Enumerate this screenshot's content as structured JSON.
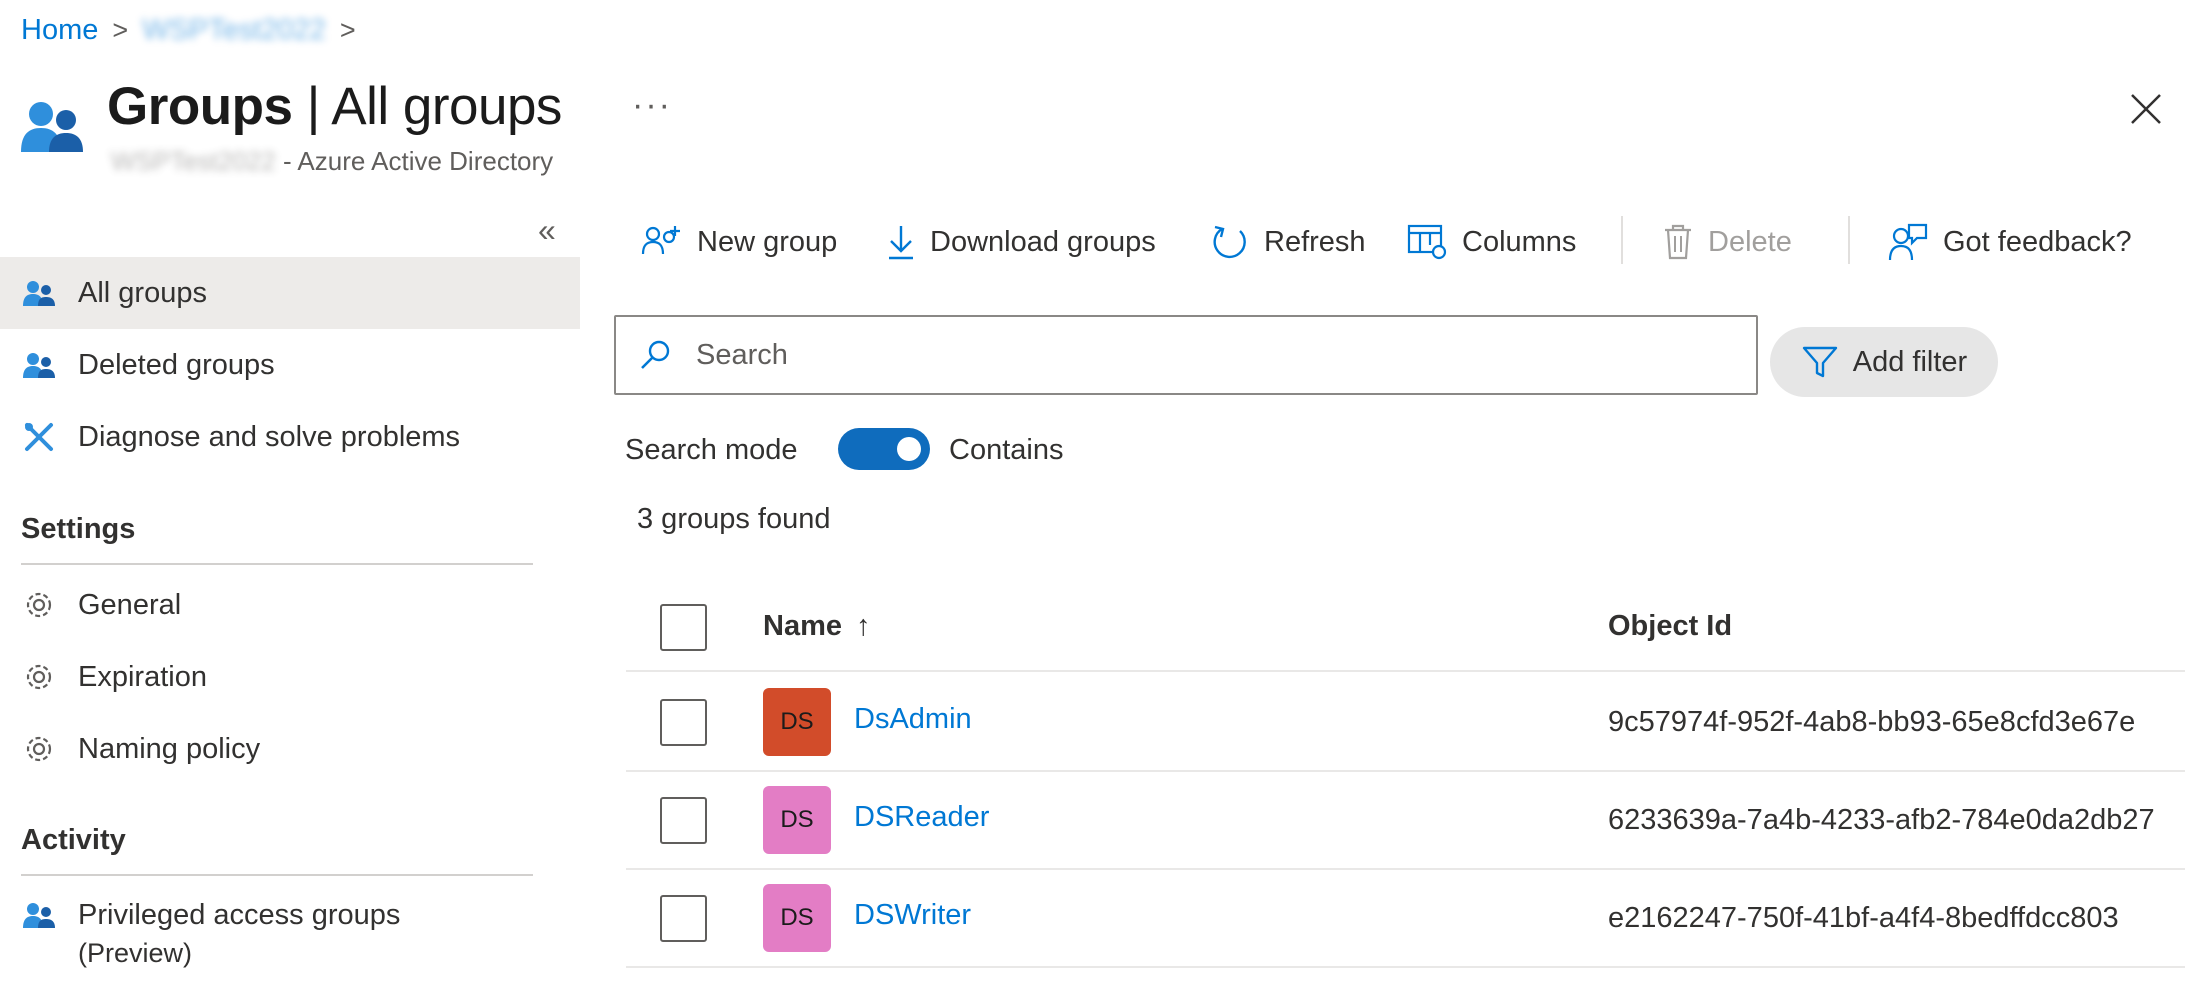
{
  "breadcrumb": {
    "home": "Home",
    "sep": ">",
    "tenant": "WSPTest2022"
  },
  "header": {
    "title": "Groups",
    "title_sep": " | ",
    "title_rest": "All groups",
    "subtitle_blurred": "WSPTest2022",
    "subtitle": " - Azure Active Directory",
    "more": "···"
  },
  "sidebar": {
    "collapse_glyph": "«",
    "items": [
      {
        "label": "All groups",
        "icon": "groups-icon",
        "active": true
      },
      {
        "label": "Deleted groups",
        "icon": "groups-icon"
      },
      {
        "label": "Diagnose and solve problems",
        "icon": "wrench-icon"
      }
    ],
    "settings": {
      "heading": "Settings",
      "items": [
        {
          "label": "General",
          "icon": "gear-icon"
        },
        {
          "label": "Expiration",
          "icon": "gear-icon"
        },
        {
          "label": "Naming policy",
          "icon": "gear-icon"
        }
      ]
    },
    "activity": {
      "heading": "Activity",
      "items": [
        {
          "label_line1": "Privileged access groups",
          "label_line2": "(Preview)",
          "icon": "groups-icon"
        }
      ]
    }
  },
  "toolbar": {
    "new_group": "New group",
    "download_groups": "Download groups",
    "refresh": "Refresh",
    "columns": "Columns",
    "delete": "Delete",
    "feedback": "Got feedback?"
  },
  "search": {
    "placeholder": "Search",
    "value": ""
  },
  "filter": {
    "label": "Add filter"
  },
  "search_mode": {
    "label": "Search mode",
    "state": "Contains",
    "on": true
  },
  "results": {
    "count_text": "3 groups found"
  },
  "table": {
    "headers": {
      "name": "Name",
      "sort_arrow": "↑",
      "object_id": "Object Id"
    },
    "rows": [
      {
        "initials": "DS",
        "name": "DsAdmin",
        "object_id": "9c57974f-952f-4ab8-bb93-65e8cfd3e67e",
        "color": "#d24c2a"
      },
      {
        "initials": "DS",
        "name": "DSReader",
        "object_id": "6233639a-7a4b-4233-afb2-784e0da2db27",
        "color": "#e37dc5"
      },
      {
        "initials": "DS",
        "name": "DSWriter",
        "object_id": "e2162247-750f-41bf-a4f4-8bedffdcc803",
        "color": "#e37dc5"
      }
    ]
  },
  "colors": {
    "accent": "#0078d4",
    "toggle": "#0f6cbd",
    "active_nav": "#edebe9"
  }
}
